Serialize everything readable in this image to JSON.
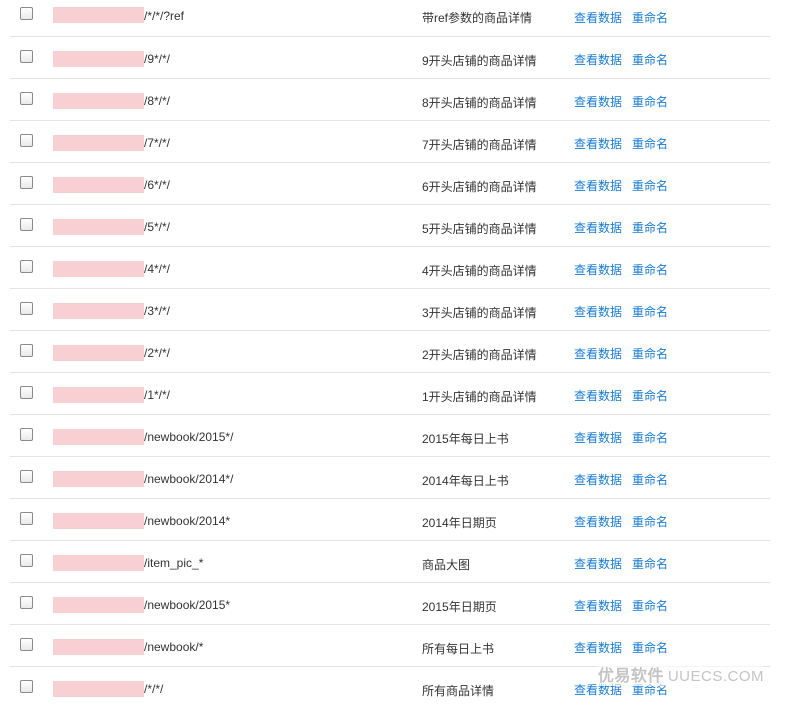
{
  "actions": {
    "view_label": "查看数据",
    "rename_label": "重命名"
  },
  "rules": [
    {
      "path": "/*/*/?ref",
      "desc": "带ref参数的商品详情"
    },
    {
      "path": "/9*/*/",
      "desc": "9开头店铺的商品详情"
    },
    {
      "path": "/8*/*/",
      "desc": "8开头店铺的商品详情"
    },
    {
      "path": "/7*/*/",
      "desc": "7开头店铺的商品详情"
    },
    {
      "path": "/6*/*/",
      "desc": "6开头店铺的商品详情"
    },
    {
      "path": "/5*/*/",
      "desc": "5开头店铺的商品详情"
    },
    {
      "path": "/4*/*/",
      "desc": "4开头店铺的商品详情"
    },
    {
      "path": "/3*/*/",
      "desc": "3开头店铺的商品详情"
    },
    {
      "path": "/2*/*/",
      "desc": "2开头店铺的商品详情"
    },
    {
      "path": "/1*/*/",
      "desc": "1开头店铺的商品详情"
    },
    {
      "path": "/newbook/2015*/",
      "desc": "2015年每日上书"
    },
    {
      "path": "/newbook/2014*/",
      "desc": "2014年每日上书"
    },
    {
      "path": "/newbook/2014*",
      "desc": "2014年日期页"
    },
    {
      "path": "/item_pic_*",
      "desc": "商品大图"
    },
    {
      "path": "/newbook/2015*",
      "desc": "2015年日期页"
    },
    {
      "path": "/newbook/*",
      "desc": "所有每日上书"
    },
    {
      "path": "/*/*/",
      "desc": "所有商品详情"
    }
  ],
  "watermark": {
    "cn": "优易软件",
    "en": "UUECS.COM"
  }
}
